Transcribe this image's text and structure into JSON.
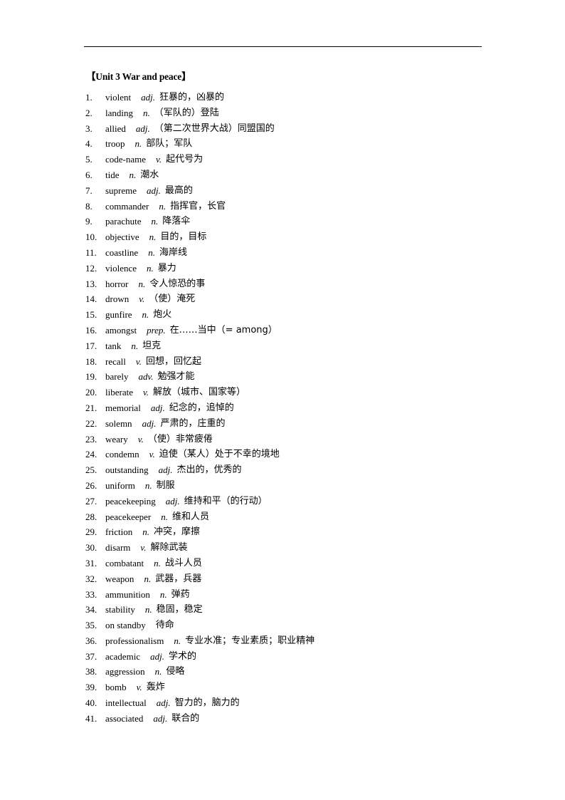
{
  "document": {
    "unit_title": "【Unit 3 War and peace】",
    "entries": [
      {
        "num": "1.",
        "word": "violent",
        "pos": "adj.",
        "meaning": "狂暴的，凶暴的"
      },
      {
        "num": "2.",
        "word": "landing",
        "pos": "n.",
        "meaning": "（军队的）登陆"
      },
      {
        "num": "3.",
        "word": "allied",
        "pos": "adj.",
        "meaning": "（第二次世界大战）同盟国的"
      },
      {
        "num": "4.",
        "word": "troop",
        "pos": "n.",
        "meaning": "部队；军队"
      },
      {
        "num": "5.",
        "word": "code-name",
        "pos": "v.",
        "meaning": "起代号为"
      },
      {
        "num": "6.",
        "word": "tide",
        "pos": "n.",
        "meaning": "潮水"
      },
      {
        "num": "7.",
        "word": "supreme",
        "pos": "adj.",
        "meaning": "最高的"
      },
      {
        "num": "8.",
        "word": "commander",
        "pos": "n.",
        "meaning": "指挥官，长官"
      },
      {
        "num": "9.",
        "word": "parachute",
        "pos": "n.",
        "meaning": "降落伞"
      },
      {
        "num": "10.",
        "word": "objective",
        "pos": "n.",
        "meaning": "目的，目标"
      },
      {
        "num": "11.",
        "word": "coastline",
        "pos": "n.",
        "meaning": "海岸线"
      },
      {
        "num": "12.",
        "word": "violence",
        "pos": "n.",
        "meaning": "暴力"
      },
      {
        "num": "13.",
        "word": "horror",
        "pos": "n.",
        "meaning": "令人惊恐的事"
      },
      {
        "num": "14.",
        "word": "drown",
        "pos": "v.",
        "meaning": "（使）淹死"
      },
      {
        "num": "15.",
        "word": "gunfire",
        "pos": "n.",
        "meaning": "炮火"
      },
      {
        "num": "16.",
        "word": "amongst",
        "pos": "prep.",
        "meaning": "在……当中（= among）"
      },
      {
        "num": "17.",
        "word": "tank",
        "pos": "n.",
        "meaning": "坦克"
      },
      {
        "num": "18.",
        "word": "recall",
        "pos": "v.",
        "meaning": "回想，回忆起"
      },
      {
        "num": "19.",
        "word": "barely",
        "pos": "adv.",
        "meaning": "勉强才能"
      },
      {
        "num": "20.",
        "word": "liberate",
        "pos": "v.",
        "meaning": "解放（城市、国家等）"
      },
      {
        "num": "21.",
        "word": "memorial",
        "pos": "adj.",
        "meaning": "纪念的，追悼的"
      },
      {
        "num": "22.",
        "word": "solemn",
        "pos": "adj.",
        "meaning": "严肃的，庄重的"
      },
      {
        "num": "23.",
        "word": "weary",
        "pos": "v.",
        "meaning": "（使）非常疲倦"
      },
      {
        "num": "24.",
        "word": "condemn",
        "pos": "v.",
        "meaning": "迫使（某人）处于不幸的境地"
      },
      {
        "num": "25.",
        "word": "outstanding",
        "pos": "adj.",
        "meaning": "杰出的，优秀的"
      },
      {
        "num": "26.",
        "word": "uniform",
        "pos": "n.",
        "meaning": "制服"
      },
      {
        "num": "27.",
        "word": "peacekeeping",
        "pos": "adj.",
        "meaning": "维持和平（的行动）"
      },
      {
        "num": "28.",
        "word": "peacekeeper",
        "pos": "n.",
        "meaning": "维和人员"
      },
      {
        "num": "29.",
        "word": "friction",
        "pos": "n.",
        "meaning": "冲突，摩擦"
      },
      {
        "num": "30.",
        "word": "disarm",
        "pos": "v.",
        "meaning": "解除武装"
      },
      {
        "num": "31.",
        "word": "combatant",
        "pos": "n.",
        "meaning": "战斗人员"
      },
      {
        "num": "32.",
        "word": "weapon",
        "pos": "n.",
        "meaning": "武器，兵器"
      },
      {
        "num": "33.",
        "word": "ammunition",
        "pos": "n.",
        "meaning": "弹药"
      },
      {
        "num": "34.",
        "word": "stability",
        "pos": "n.",
        "meaning": "稳固，稳定"
      },
      {
        "num": "35.",
        "word": "on standby",
        "pos": "",
        "meaning": "待命"
      },
      {
        "num": "36.",
        "word": "professionalism",
        "pos": "n.",
        "meaning": "专业水准；专业素质；职业精神"
      },
      {
        "num": "37.",
        "word": "academic",
        "pos": "adj.",
        "meaning": "学术的"
      },
      {
        "num": "38.",
        "word": "aggression",
        "pos": "n.",
        "meaning": "侵略"
      },
      {
        "num": "39.",
        "word": "bomb",
        "pos": "v.",
        "meaning": "轰炸"
      },
      {
        "num": "40.",
        "word": "intellectual",
        "pos": "adj.",
        "meaning": "智力的，脑力的"
      },
      {
        "num": "41.",
        "word": "associated",
        "pos": "adj.",
        "meaning": "联合的"
      }
    ]
  }
}
